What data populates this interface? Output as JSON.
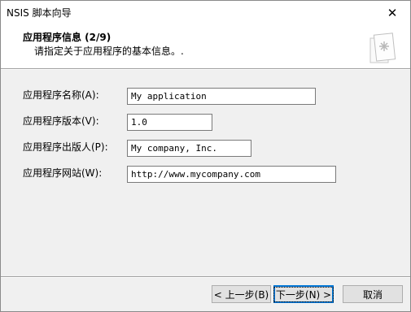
{
  "window": {
    "title": "NSIS 脚本向导"
  },
  "header": {
    "title": "应用程序信息 (2/9)",
    "subtitle": "请指定关于应用程序的基本信息。."
  },
  "form": {
    "app_name": {
      "label": "应用程序名称(A):",
      "value": "My application"
    },
    "app_version": {
      "label": "应用程序版本(V):",
      "value": "1.0"
    },
    "app_publisher": {
      "label": "应用程序出版人(P):",
      "value": "My company, Inc."
    },
    "app_website": {
      "label": "应用程序网站(W):",
      "value": "http://www.mycompany.com"
    }
  },
  "buttons": {
    "back": "< 上一步(B)",
    "next": "下一步(N) >",
    "cancel": "取消"
  },
  "colors": {
    "header_bg": "#ffffff",
    "body_bg": "#f0f0f0",
    "accent": "#0078d7"
  }
}
